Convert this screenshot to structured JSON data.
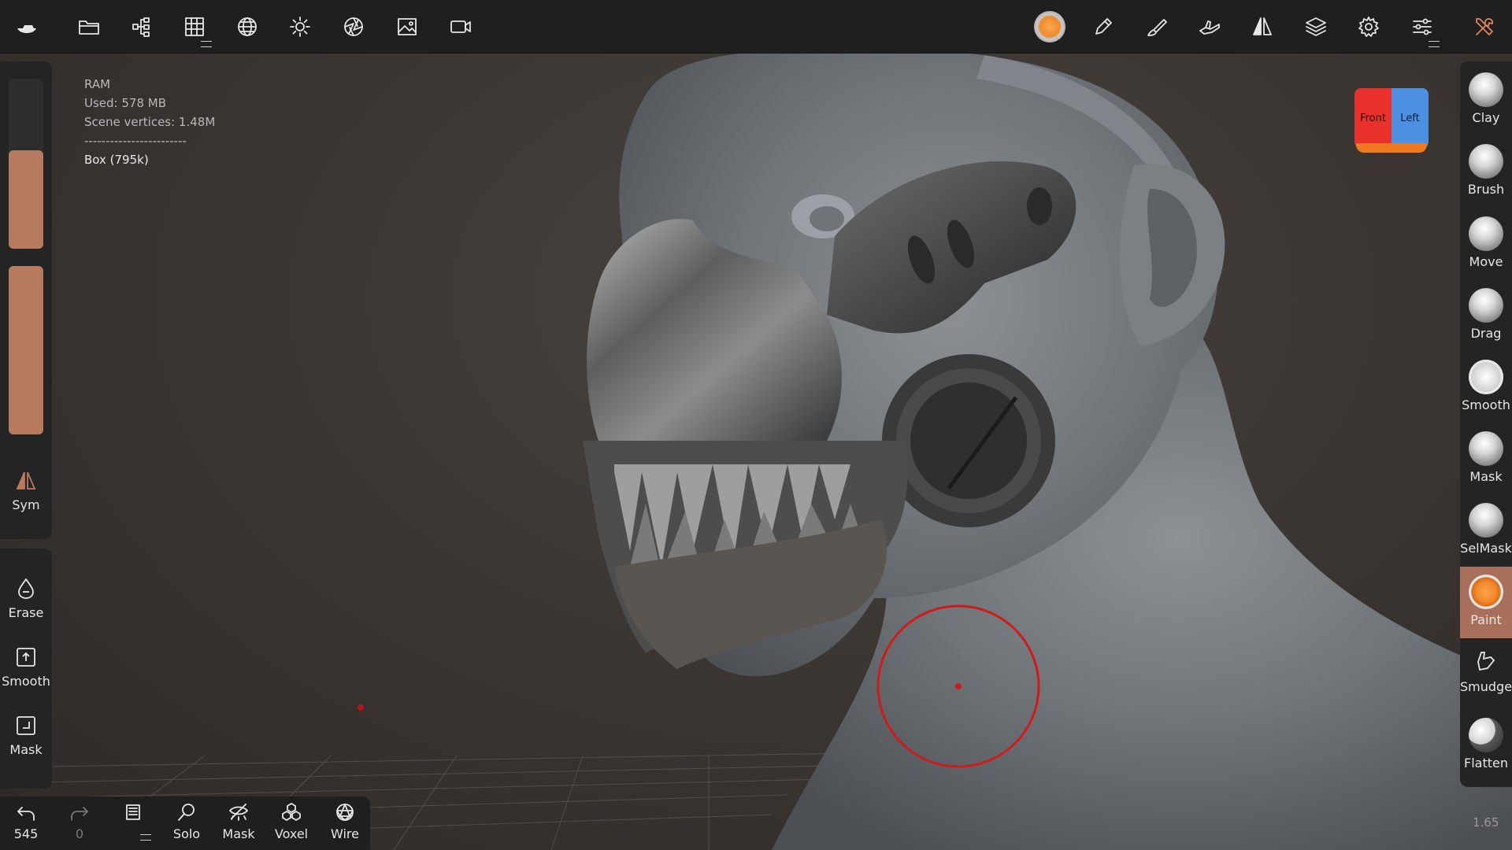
{
  "toolbar": {
    "icons": [
      "boat-logo-icon",
      "folder-icon",
      "scene-tree-icon",
      "grid-icon",
      "sphere-mesh-icon",
      "sun-icon",
      "aperture-icon",
      "image-icon",
      "video-camera-icon"
    ],
    "right_icons": [
      "material-sphere-icon",
      "pencil-icon",
      "paint-brush-icon",
      "hand-drag-icon",
      "symmetry-icon",
      "layers-icon",
      "gear-icon",
      "sliders-icon",
      "tools-icon"
    ]
  },
  "info": {
    "ram_label": "RAM",
    "used": "Used: 578 MB",
    "vertices": "Scene vertices: 1.48M",
    "separator": "------------------------",
    "object": "Box (795k)"
  },
  "left_panel": {
    "radius_value": 0.58,
    "intensity_value": 1.0,
    "sym_label": "Sym",
    "tools": [
      {
        "label": "Erase",
        "icon": "drop-icon"
      },
      {
        "label": "Smooth",
        "icon": "smooth-box-icon"
      },
      {
        "label": "Mask",
        "icon": "mask-box-icon"
      }
    ]
  },
  "right_panel": {
    "tools": [
      {
        "label": "Clay"
      },
      {
        "label": "Brush"
      },
      {
        "label": "Move"
      },
      {
        "label": "Drag"
      },
      {
        "label": "Smooth"
      },
      {
        "label": "Mask"
      },
      {
        "label": "SelMask"
      },
      {
        "label": "Paint",
        "active": true
      },
      {
        "label": "Smudge"
      },
      {
        "label": "Flatten"
      }
    ]
  },
  "bottom_bar": {
    "undo_count": "545",
    "redo_count": "0",
    "solo": "Solo",
    "mask": "Mask",
    "voxel": "Voxel",
    "wire": "Wire"
  },
  "view_cube": {
    "front": "Front",
    "left": "Left"
  },
  "zoom": "1.65",
  "colors": {
    "accent": "#b67b5e",
    "brush_ring": "#d11a1a"
  }
}
